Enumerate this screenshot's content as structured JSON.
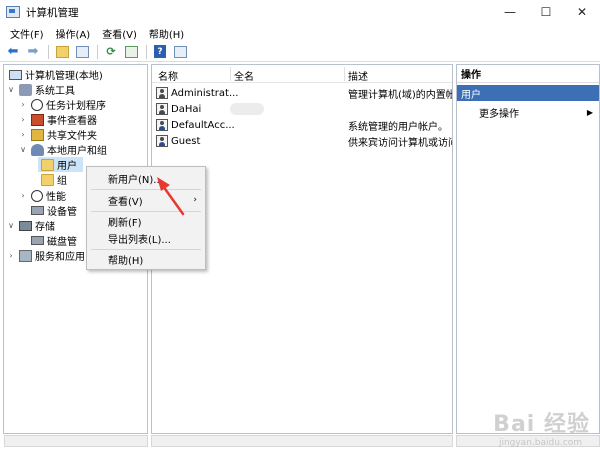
{
  "window": {
    "title": "计算机管理",
    "controls": [
      "—",
      "☐",
      "✕"
    ]
  },
  "menubar": {
    "items": [
      "文件(F)",
      "操作(A)",
      "查看(V)",
      "帮助(H)"
    ]
  },
  "toolbar": {
    "icons": [
      "back-icon",
      "forward-icon",
      "up-folder-icon",
      "show-hide-tree-icon",
      "refresh-icon",
      "export-icon",
      "help-icon",
      "properties-icon"
    ]
  },
  "tree": {
    "items": [
      {
        "label": "计算机管理(本地)",
        "icon": "computer-icon",
        "level": 0
      },
      {
        "label": "系统工具",
        "icon": "tools-icon",
        "level": 1,
        "expanded": true
      },
      {
        "label": "任务计划程序",
        "icon": "clock-icon",
        "level": 2
      },
      {
        "label": "事件查看器",
        "icon": "event-viewer-icon",
        "level": 2
      },
      {
        "label": "共享文件夹",
        "icon": "shared-folder-icon",
        "level": 2
      },
      {
        "label": "本地用户和组",
        "icon": "users-group-icon",
        "level": 2,
        "expanded": true
      },
      {
        "label": "用户",
        "icon": "folder-icon",
        "level": 3,
        "selected": true
      },
      {
        "label": "组",
        "icon": "folder-icon",
        "level": 3
      },
      {
        "label": "性能",
        "icon": "performance-icon",
        "level": 2
      },
      {
        "label": "设备管",
        "icon": "device-manager-icon",
        "level": 2
      },
      {
        "label": "存储",
        "icon": "storage-icon",
        "level": 1,
        "expanded": true
      },
      {
        "label": "磁盘管",
        "icon": "disk-icon",
        "level": 2
      },
      {
        "label": "服务和应用",
        "icon": "services-icon",
        "level": 1
      }
    ]
  },
  "list": {
    "columns": [
      "名称",
      "全名",
      "描述"
    ],
    "rows": [
      {
        "name": "Administrat...",
        "fullname": "",
        "desc": "管理计算机(域)的内置帐户",
        "icon": "user-icon"
      },
      {
        "name": "DaHai",
        "fullname": "",
        "desc": "",
        "icon": "user-icon"
      },
      {
        "name": "DefaultAcc...",
        "fullname": "",
        "desc": "系统管理的用户帐户。",
        "icon": "user-disabled-icon"
      },
      {
        "name": "Guest",
        "fullname": "",
        "desc": "供来宾访问计算机或访问",
        "icon": "user-disabled-icon"
      }
    ]
  },
  "actions": {
    "header": "操作",
    "section": "用户",
    "more": "更多操作",
    "more_arrow": "▶"
  },
  "context_menu": {
    "items": [
      {
        "label": "新用户(N)...",
        "submenu": false
      },
      {
        "label": "查看(V)",
        "submenu": true,
        "arrow": "›"
      },
      {
        "label": "刷新(F)",
        "submenu": false
      },
      {
        "label": "导出列表(L)...",
        "submenu": false
      },
      {
        "label": "帮助(H)",
        "submenu": false
      }
    ]
  },
  "watermark": {
    "main": "Bai 经验",
    "sub": "jingyan.baidu.com"
  },
  "colors": {
    "accent": "#3c6fb5",
    "selection": "#cce4f7",
    "annotation": "#e8392f"
  }
}
